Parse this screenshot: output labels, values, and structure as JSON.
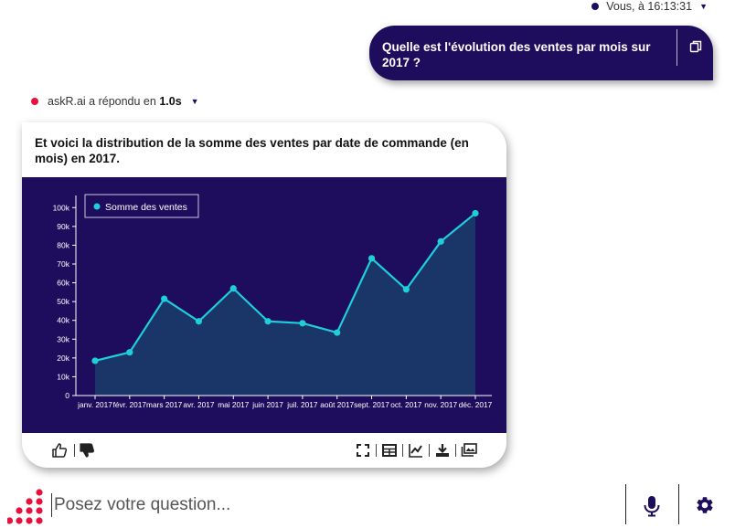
{
  "user": {
    "meta": "Vous, à 16:13:31",
    "question": "Quelle est l'évolution des ventes par mois sur 2017 ?"
  },
  "bot": {
    "meta_prefix": "askR.ai a répondu en",
    "meta_time": "1.0s",
    "title": "Et voici la distribution de la somme des ventes par date de commande (en mois) en 2017."
  },
  "input": {
    "placeholder": "Posez votre question..."
  },
  "colors": {
    "brand": "#1e0d5c",
    "accent": "#e6123d",
    "series": "#1fcfd8",
    "area": "#1a3568"
  },
  "chart_data": {
    "type": "area",
    "categories": [
      "janv. 2017",
      "févr. 2017",
      "mars 2017",
      "avr. 2017",
      "mai 2017",
      "juin 2017",
      "juil. 2017",
      "août 2017",
      "sept. 2017",
      "oct. 2017",
      "nov. 2017",
      "déc. 2017"
    ],
    "series": [
      {
        "name": "Somme des ventes",
        "values": [
          18500,
          23000,
          51500,
          39500,
          57000,
          39500,
          38500,
          33500,
          73000,
          56500,
          82000,
          97000
        ]
      }
    ],
    "yticks": [
      "0",
      "10k",
      "20k",
      "30k",
      "40k",
      "50k",
      "60k",
      "70k",
      "80k",
      "90k",
      "100k"
    ],
    "ylim": [
      0,
      105000
    ],
    "legend": "top-left",
    "grid": false
  }
}
